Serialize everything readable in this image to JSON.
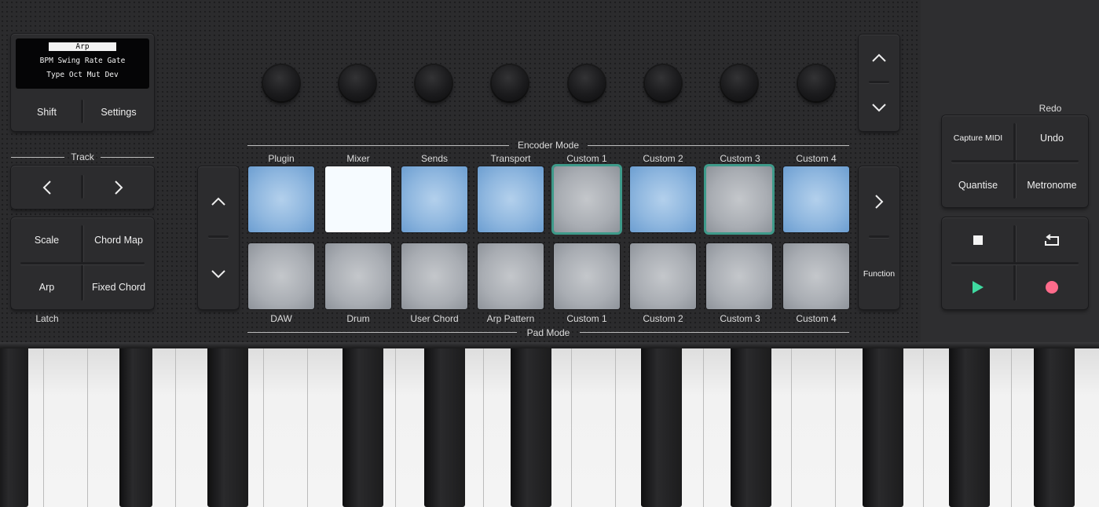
{
  "screen": {
    "title": "Arp",
    "line1": "BPM Swing Rate Gate",
    "line2": "Type Oct  Mut Dev"
  },
  "left": {
    "shift_label": "Shift",
    "settings_label": "Settings",
    "track_label": "Track",
    "scale_label": "Scale",
    "chord_map_label": "Chord Map",
    "arp_label": "Arp",
    "fixed_chord_label": "Fixed Chord",
    "latch_label": "Latch"
  },
  "encoder_mode_label": "Encoder Mode",
  "pad_mode_label": "Pad Mode",
  "top_pad_labels": [
    "Plugin",
    "Mixer",
    "Sends",
    "Transport",
    "Custom 1",
    "Custom 2",
    "Custom 3",
    "Custom 4"
  ],
  "bottom_pad_labels": [
    "DAW",
    "Drum",
    "User Chord",
    "Arp Pattern",
    "Custom 1",
    "Custom 2",
    "Custom 3",
    "Custom 4"
  ],
  "top_pad_states": [
    "blue",
    "white",
    "blue",
    "blue",
    "grey sel",
    "blue",
    "grey sel",
    "blue"
  ],
  "function_label": "Function",
  "right": {
    "redo_label": "Redo",
    "capture_midi_label": "Capture MIDI",
    "undo_label": "Undo",
    "quantise_label": "Quantise",
    "metronome_label": "Metronome"
  },
  "colors": {
    "play": "#3fd9a0",
    "record": "#ff6b8b",
    "selected_outline": "#3e9a8a"
  },
  "icons": {
    "stop": "stop-icon",
    "loop": "loop-icon",
    "play": "play-icon",
    "record": "record-icon"
  }
}
